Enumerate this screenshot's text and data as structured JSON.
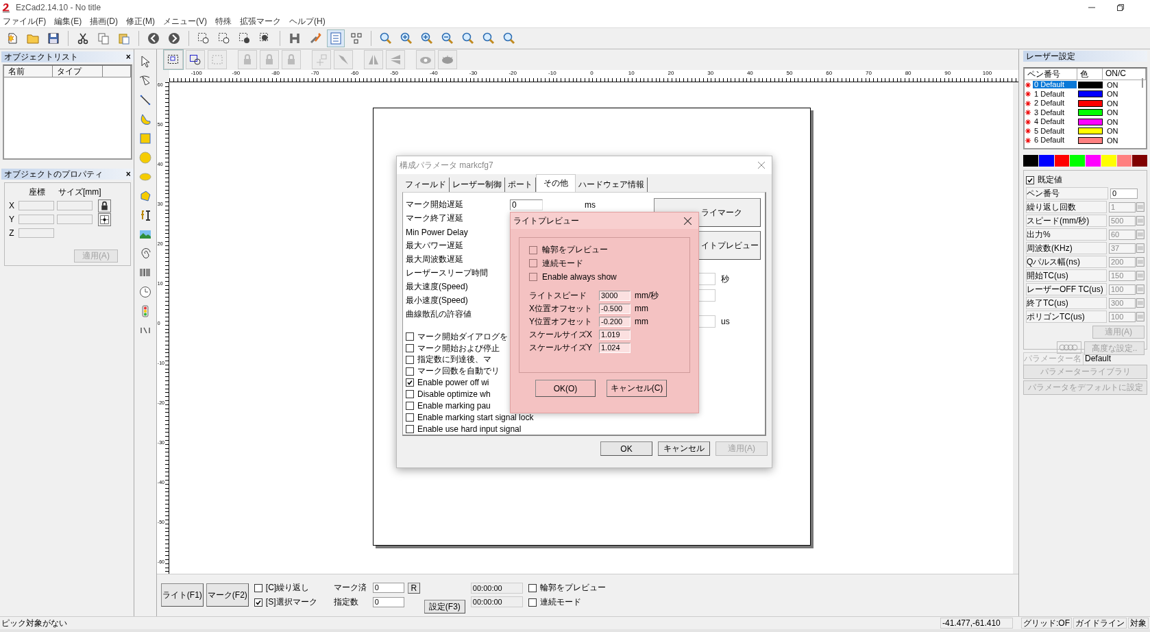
{
  "window": {
    "title": "EzCad2.14.10 - No title"
  },
  "menu": [
    "ファイル(F)",
    "編集(E)",
    "描画(D)",
    "修正(M)",
    "メニュー(V)",
    "特殊",
    "拡張マーク",
    "ヘルプ(H)"
  ],
  "object_list": {
    "title": "オブジェクトリスト",
    "close": "×",
    "columns": [
      "名前",
      "タイプ"
    ]
  },
  "object_properties": {
    "title": "オブジェクトのプロパティ",
    "close": "×",
    "headers": [
      "座標",
      "サイズ[mm]"
    ],
    "axes": [
      "X",
      "Y",
      "Z"
    ],
    "apply": {
      "label": "適用(A)",
      "disabled": true
    }
  },
  "ruler": {
    "x_labels": [
      "-100",
      "-90",
      "-80",
      "-70",
      "-60",
      "-50",
      "-40",
      "-30",
      "-20",
      "-10",
      "0",
      "10",
      "20",
      "30",
      "40",
      "50",
      "60",
      "70",
      "80",
      "90",
      "100"
    ],
    "y_labels": [
      "60",
      "50",
      "40",
      "30",
      "20",
      "10",
      "0",
      "-10",
      "-20",
      "-30",
      "-40",
      "-50",
      "-60"
    ]
  },
  "config_dialog": {
    "title": "構成パラメータ markcfg7",
    "tabs": [
      {
        "label": "フィールド",
        "selected": false
      },
      {
        "label": "レーザー制御",
        "selected": false
      },
      {
        "label": "ポート",
        "selected": false
      },
      {
        "label": "その他",
        "selected": true
      },
      {
        "label": "ハードウェア情報",
        "selected": false
      }
    ],
    "fields": [
      {
        "label": "マーク開始遅延",
        "value": "0",
        "unit": "ms"
      },
      {
        "label": "マーク終了遅延"
      },
      {
        "label": "Min Power Delay"
      },
      {
        "label": "最大パワー遅延"
      },
      {
        "label": "最大周波数遅延"
      },
      {
        "label": "レーザースリープ時間"
      },
      {
        "label": "最大速度(Speed)"
      },
      {
        "label": "最小速度(Speed)"
      },
      {
        "label": "曲線散乱の許容値"
      }
    ],
    "options": [
      {
        "label": "マーク開始ダイアログを",
        "checked": false
      },
      {
        "label": "マーク開始および停止",
        "checked": false
      },
      {
        "label": "指定数に到達後、マ",
        "checked": false
      },
      {
        "label": "マーク回数を自動でリ",
        "checked": false
      },
      {
        "label": "Enable power off wi",
        "checked": true
      },
      {
        "label": "Disable optimize wh",
        "checked": false
      },
      {
        "label": "Enable marking pau",
        "checked": false
      },
      {
        "label": "Enable marking start signal lock",
        "checked": false
      },
      {
        "label": "Enable use hard input signal",
        "checked": false
      }
    ],
    "side_buttons": [
      "ライマーク",
      "イトプレビュー"
    ],
    "side_units": [
      "秒",
      "us"
    ],
    "buttons": [
      {
        "label": "OK",
        "disabled": false
      },
      {
        "label": "キャンセル",
        "disabled": false
      },
      {
        "label": "適用(A)",
        "disabled": true
      }
    ]
  },
  "light_preview": {
    "title": "ライトプレビュー",
    "options": [
      {
        "label": "輪郭をプレビュー",
        "checked": false
      },
      {
        "label": "連続モード",
        "checked": false
      },
      {
        "label": "Enable always show",
        "checked": false
      }
    ],
    "fields": [
      {
        "label": "ライトスピード",
        "value": "3000",
        "unit": "mm/秒"
      },
      {
        "label": "X位置オフセット",
        "value": "-0.500",
        "unit": "mm"
      },
      {
        "label": "Y位置オフセット",
        "value": "-0.200",
        "unit": "mm"
      },
      {
        "label": "スケールサイズX",
        "value": "1.019"
      },
      {
        "label": "スケールサイズY",
        "value": "1.024"
      }
    ],
    "buttons": [
      "OK(O)",
      "キャンセル(C)"
    ]
  },
  "laser_settings": {
    "title": "レーザー設定",
    "columns": [
      "ペン番号",
      "色",
      "ON/C"
    ],
    "pens": [
      {
        "name": "0 Default",
        "color": "#000000",
        "state": "ON",
        "selected": true
      },
      {
        "name": "1 Default",
        "color": "#0000ff",
        "state": "ON",
        "selected": false
      },
      {
        "name": "2 Default",
        "color": "#ff0000",
        "state": "ON",
        "selected": false
      },
      {
        "name": "3 Default",
        "color": "#00ff00",
        "state": "ON",
        "selected": false
      },
      {
        "name": "4 Default",
        "color": "#ff00ff",
        "state": "ON",
        "selected": false
      },
      {
        "name": "5 Default",
        "color": "#ffff00",
        "state": "ON",
        "selected": false
      },
      {
        "name": "6 Default",
        "color": "#ff8080",
        "state": "ON",
        "selected": false
      }
    ],
    "palette": [
      {
        "color": "#000000"
      },
      {
        "color": "#0000ff"
      },
      {
        "color": "#ff0000"
      },
      {
        "color": "#00ff00"
      },
      {
        "color": "#ff00ff"
      },
      {
        "color": "#ffff00"
      },
      {
        "color": "#ff8080"
      },
      {
        "color": "#800000"
      }
    ],
    "default": {
      "label": "既定値",
      "checked": true
    },
    "params": [
      {
        "label": "ペン番号",
        "value": "0",
        "kind": "number",
        "disabled": false
      },
      {
        "label": "繰り返し回数",
        "value": "1",
        "kind": "spin",
        "disabled": true
      },
      {
        "label": "スピード(mm/秒)",
        "value": "500",
        "kind": "spin",
        "disabled": true
      },
      {
        "label": "出力%",
        "value": "60",
        "kind": "spin",
        "disabled": true
      },
      {
        "label": "周波数(KHz)",
        "value": "37",
        "kind": "spin",
        "disabled": true
      },
      {
        "label": "Qパルス幅(ns)",
        "value": "200",
        "kind": "spin",
        "disabled": true
      },
      {
        "label": "開始TC(us)",
        "value": "150",
        "kind": "spin",
        "disabled": true
      },
      {
        "label": "レーザーOFF TC(us)",
        "value": "100",
        "kind": "spin",
        "disabled": true
      },
      {
        "label": "終了TC(us)",
        "value": "300",
        "kind": "spin",
        "disabled": true
      },
      {
        "label": "ポリゴンTC(us)",
        "value": "100",
        "kind": "spin",
        "disabled": true
      }
    ],
    "apply": {
      "label": "適用(A)",
      "disabled": true
    },
    "advanced": {
      "label": "高度な設定..",
      "disabled": true
    },
    "param_name": {
      "label": "パラメーター名",
      "value": "Default"
    },
    "buttons": [
      {
        "label": "パラメーターライブラリ",
        "disabled": true
      },
      {
        "label": "パラメータをデフォルトに設定",
        "disabled": true
      }
    ]
  },
  "bottom_controls": {
    "buttons": [
      "ライト(F1)",
      "マーク(F2)"
    ],
    "checks": [
      {
        "label": "[C]繰り返し",
        "checked": false
      },
      {
        "label": "[S]選択マーク",
        "checked": true
      }
    ],
    "counters": [
      {
        "label": "マーク済",
        "value": "0"
      },
      {
        "label": "指定数",
        "value": "0"
      }
    ],
    "reset": "R",
    "settings": "設定(F3)",
    "times": [
      "00:00:00",
      "00:00:00"
    ],
    "preview_checks": [
      {
        "label": "輪郭をプレビュー",
        "checked": false
      },
      {
        "label": "連続モード",
        "checked": false
      }
    ]
  },
  "status_bar": {
    "message": "ピック対象がない",
    "coords": "-41.477,-61.410",
    "grid": "グリッド:OF",
    "guide": "ガイドライン",
    "target": "対象"
  }
}
